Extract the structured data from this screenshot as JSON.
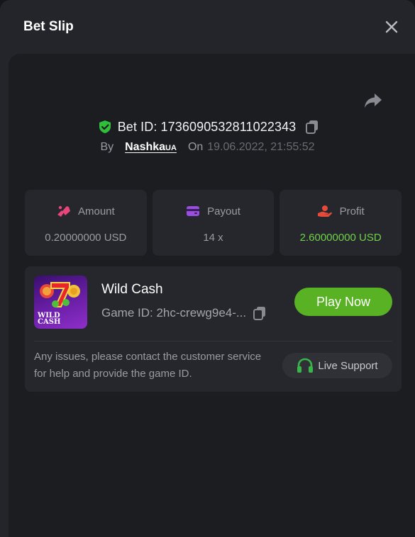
{
  "modal": {
    "title": "Bet Slip"
  },
  "bet": {
    "id_text": "Bet ID: 1736090532811022343",
    "by_label": "By",
    "username": "Nashka",
    "username_suffix": "UA",
    "on_label": "On",
    "datetime": "19.06.2022, 21:55:52"
  },
  "stats": [
    {
      "label": "Amount",
      "value": "0.20000000 USD",
      "icon": "bet-amount-icon",
      "icon_color": "#e8457a"
    },
    {
      "label": "Payout",
      "value": "14 x",
      "icon": "wallet-icon",
      "icon_color": "#9a4ee0"
    },
    {
      "label": "Profit",
      "value": "2.60000000 USD",
      "icon": "profit-hand-icon",
      "icon_color": "#e84a3a",
      "value_color": "#6fd04a"
    }
  ],
  "game": {
    "name": "Wild Cash",
    "id_text": "Game ID: 2hc-crewg9e4-...",
    "thumb_title_1": "WILD",
    "thumb_title_2": "CASH",
    "play_label": "Play Now",
    "issues_text": "Any issues, please contact the customer service for help and provide the game ID.",
    "support_label": "Live Support"
  },
  "colors": {
    "accent_green": "#59b224",
    "profit_green": "#6fd04a",
    "shield_green": "#2fbf3a"
  }
}
